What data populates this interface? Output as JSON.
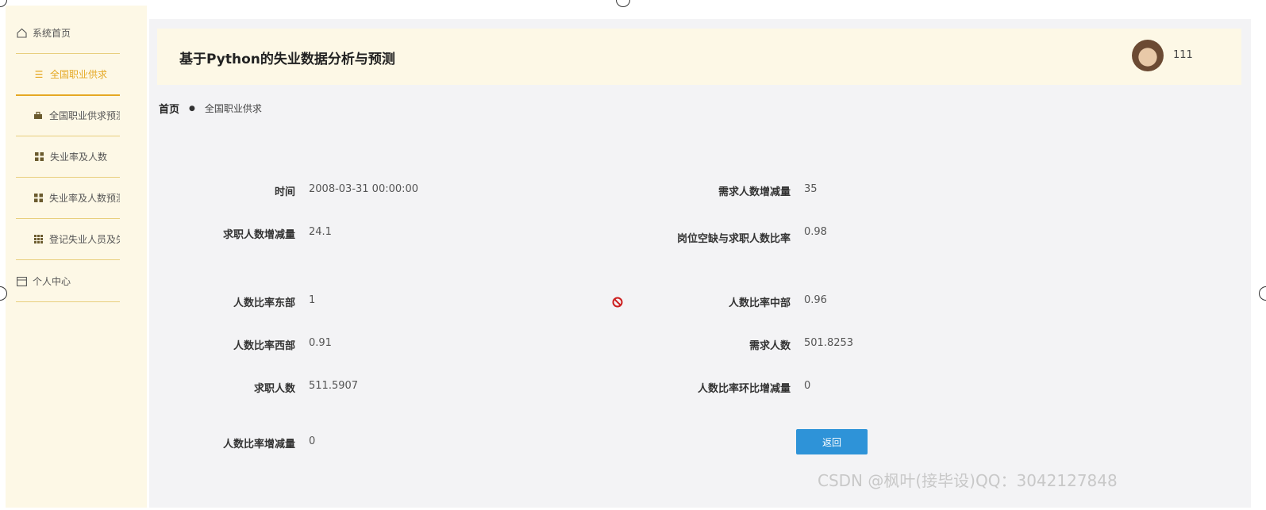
{
  "sidebar": {
    "home_label": "系统首页",
    "items": [
      {
        "label": "全国职业供求",
        "icon": "list-icon"
      },
      {
        "label": "全国职业供求预测",
        "icon": "briefcase-icon"
      },
      {
        "label": "失业率及人数",
        "icon": "grid-icon"
      },
      {
        "label": "失业率及人数预测",
        "icon": "grid-icon"
      },
      {
        "label": "登记失业人员及失",
        "icon": "table-icon"
      }
    ],
    "profile_label": "个人中心"
  },
  "header": {
    "title": "基于Python的失业数据分析与预测",
    "username": "111"
  },
  "breadcrumb": {
    "home": "首页",
    "current": "全国职业供求"
  },
  "detail": {
    "fields": [
      {
        "label": "时间",
        "value": "2008-03-31 00:00:00"
      },
      {
        "label": "需求人数增减量",
        "value": "35"
      },
      {
        "label": "求职人数增减量",
        "value": "24.1"
      },
      {
        "label": "岗位空缺与求职人数比率",
        "value": "0.98"
      },
      {
        "label": "人数比率东部",
        "value": "1"
      },
      {
        "label": "人数比率中部",
        "value": "0.96"
      },
      {
        "label": "人数比率西部",
        "value": "0.91"
      },
      {
        "label": "需求人数",
        "value": "501.8253"
      },
      {
        "label": "求职人数",
        "value": "511.5907"
      },
      {
        "label": "人数比率环比增减量",
        "value": "0"
      },
      {
        "label": "人数比率增减量",
        "value": "0"
      }
    ],
    "back_label": "返回"
  },
  "watermark": "CSDN @枫叶(接毕设)QQ：3042127848",
  "colors": {
    "accent": "#e5a823",
    "button": "#2e93d8",
    "panel": "#fdf8e6"
  }
}
